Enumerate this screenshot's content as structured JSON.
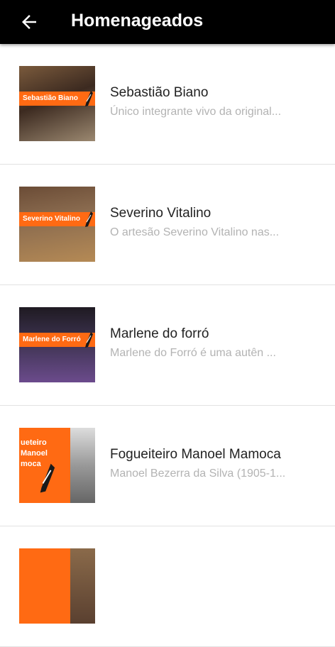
{
  "appbar": {
    "title": "Homenageados"
  },
  "items": [
    {
      "name": "Sebastião Biano",
      "desc": "Único integrante vivo da original...",
      "thumb_label": "Sebastião Biano"
    },
    {
      "name": "Severino Vitalino",
      "desc": "O artesão Severino Vitalino nas...",
      "thumb_label": "Severino Vitalino"
    },
    {
      "name": "Marlene do forró",
      "desc": "Marlene do Forró é uma autên ...",
      "thumb_label": "Marlene do Forró"
    },
    {
      "name": "Fogueiteiro Manoel Mamoca",
      "desc": "Manoel Bezerra da Silva (1905-1...",
      "thumb_label": "ueteiro\nManoel\nmoca"
    }
  ],
  "colors": {
    "accent": "#ff6a13",
    "appbar": "#000000"
  }
}
